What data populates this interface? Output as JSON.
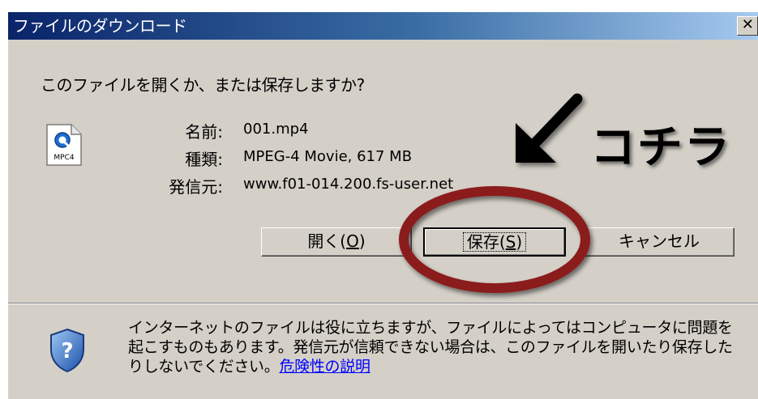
{
  "dialog": {
    "title": "ファイルのダウンロード",
    "close_glyph": "✕",
    "question": "このファイルを開くか、または保存しますか?",
    "file": {
      "icon_label": "MPC4",
      "rows": [
        {
          "label": "名前:",
          "value": "001.mp4"
        },
        {
          "label": "種類:",
          "value": "MPEG-4 Movie, 617 MB"
        },
        {
          "label": "発信元:",
          "value": "www.f01-014.200.fs-user.net"
        }
      ]
    },
    "buttons": {
      "open": {
        "text": "開く(",
        "mnemonic": "O",
        "close": ")"
      },
      "save": {
        "text": "保存(",
        "mnemonic": "S",
        "close": ")"
      },
      "cancel": {
        "text": "キャンセル"
      }
    },
    "warning": {
      "text": "インターネットのファイルは役に立ちますが、ファイルによってはコンピュータに問題を起こすものもあります。発信元が信頼できない場合は、このファイルを開いたり保存したりしないでください。",
      "link": "危険性の説明"
    }
  },
  "annotation": {
    "label": "コチラ",
    "circle_color": "#8b1a1a",
    "arrow_color": "#000000"
  }
}
